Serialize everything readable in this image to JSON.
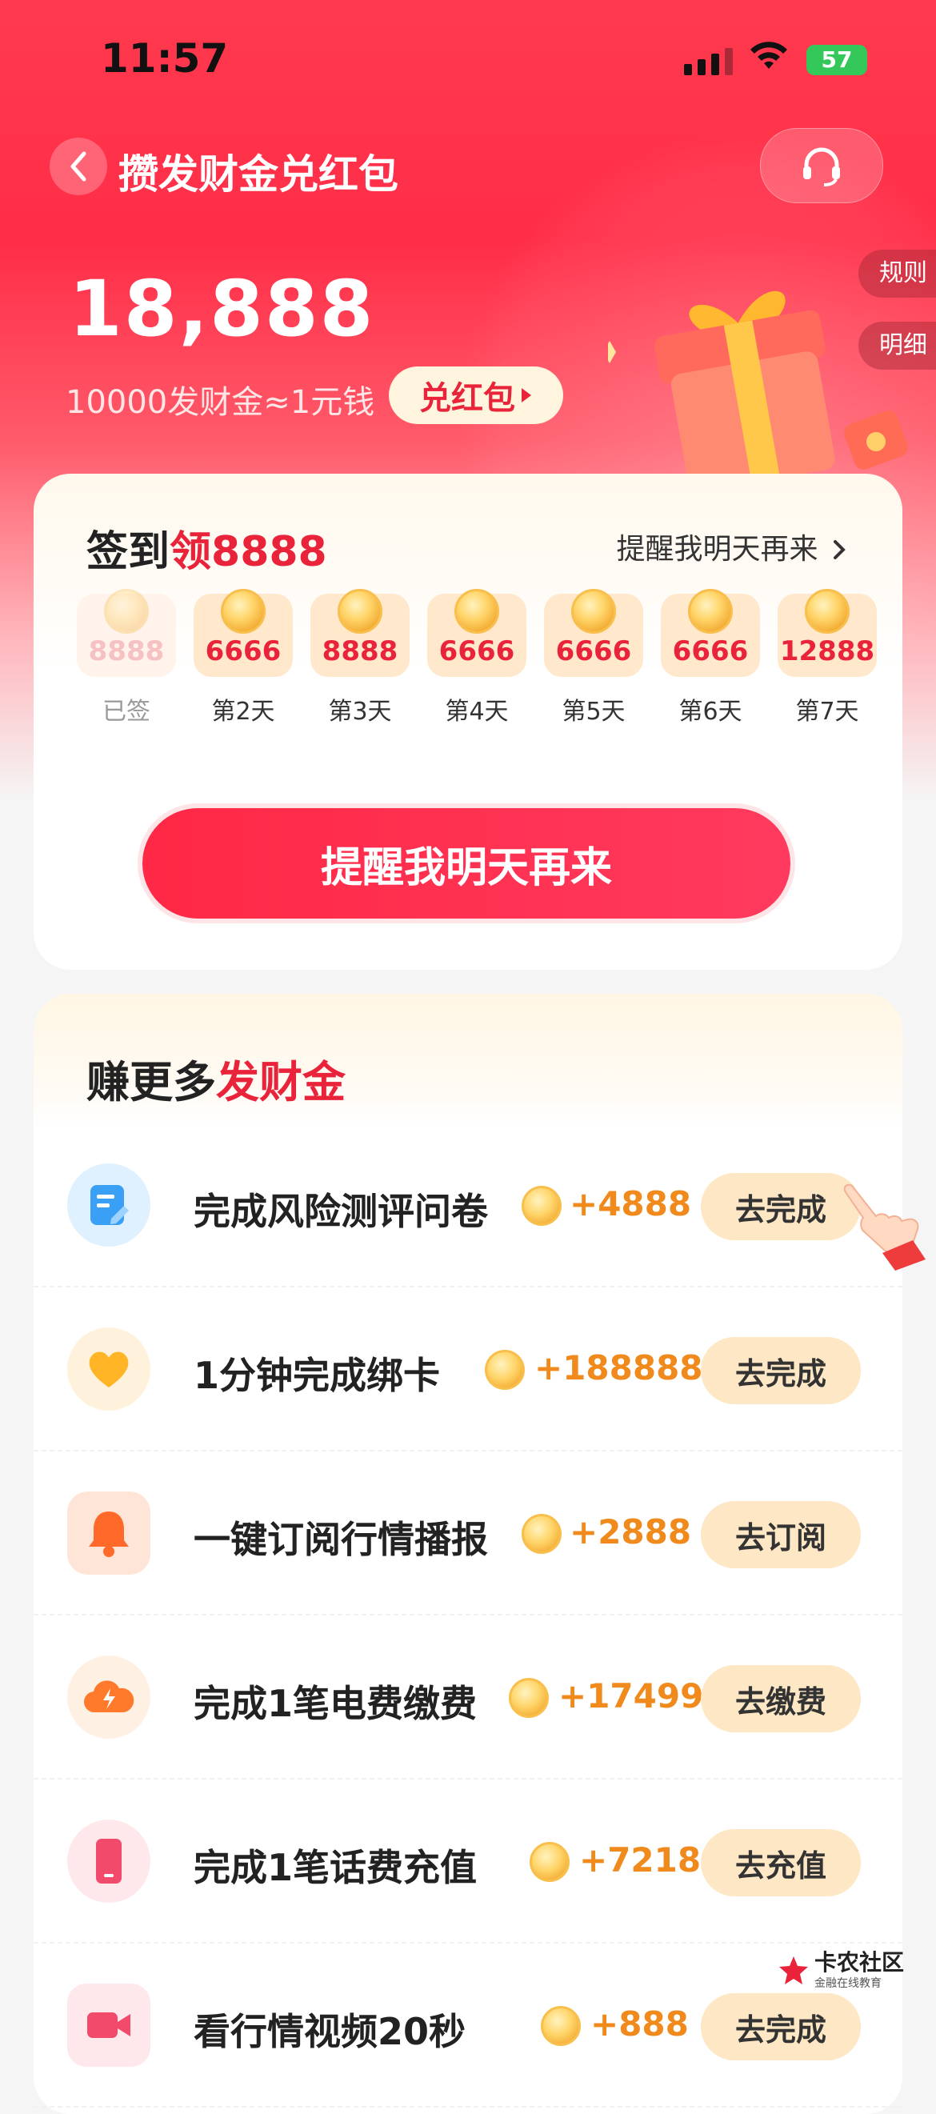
{
  "status_bar": {
    "time": "11:57",
    "battery": "57"
  },
  "header": {
    "title": "攒发财金兑红包"
  },
  "side_tabs": {
    "rules": "规则",
    "details": "明细"
  },
  "balance": {
    "amount": "18,888",
    "rate": "10000发财金≈1元钱",
    "redeem_label": "兑红包"
  },
  "checkin": {
    "title_prefix": "签到",
    "title_accent": "领8888",
    "remind_link": "提醒我明天再来",
    "days": [
      {
        "amount": "8888",
        "label": "已签",
        "signed": true
      },
      {
        "amount": "6666",
        "label": "第2天",
        "signed": false
      },
      {
        "amount": "8888",
        "label": "第3天",
        "signed": false
      },
      {
        "amount": "6666",
        "label": "第4天",
        "signed": false
      },
      {
        "amount": "6666",
        "label": "第5天",
        "signed": false
      },
      {
        "amount": "6666",
        "label": "第6天",
        "signed": false
      },
      {
        "amount": "12888",
        "label": "第7天",
        "signed": false
      }
    ],
    "button_label": "提醒我明天再来"
  },
  "earn": {
    "title_prefix": "赚更多",
    "title_accent": "发财金",
    "tasks": [
      {
        "name": "完成风险测评问卷",
        "reward": "+4888",
        "button": "去完成",
        "icon": "survey-icon"
      },
      {
        "name": "1分钟完成绑卡",
        "reward": "+188888",
        "button": "去完成",
        "icon": "heart-icon"
      },
      {
        "name": "一键订阅行情播报",
        "reward": "+2888",
        "button": "去订阅",
        "icon": "bell-icon"
      },
      {
        "name": "完成1笔电费缴费",
        "reward": "+17499",
        "button": "去缴费",
        "icon": "electricity-icon"
      },
      {
        "name": "完成1笔话费充值",
        "reward": "+7218",
        "button": "去充值",
        "icon": "phone-icon"
      },
      {
        "name": "看行情视频20秒",
        "reward": "+888",
        "button": "去完成",
        "icon": "video-icon"
      }
    ]
  },
  "watermark": {
    "name": "卡农社区",
    "tagline": "金融在线教育"
  },
  "colors": {
    "brand_red": "#e8233a",
    "reward_orange": "#f08a1c",
    "button_cream": "#fde7c4"
  }
}
